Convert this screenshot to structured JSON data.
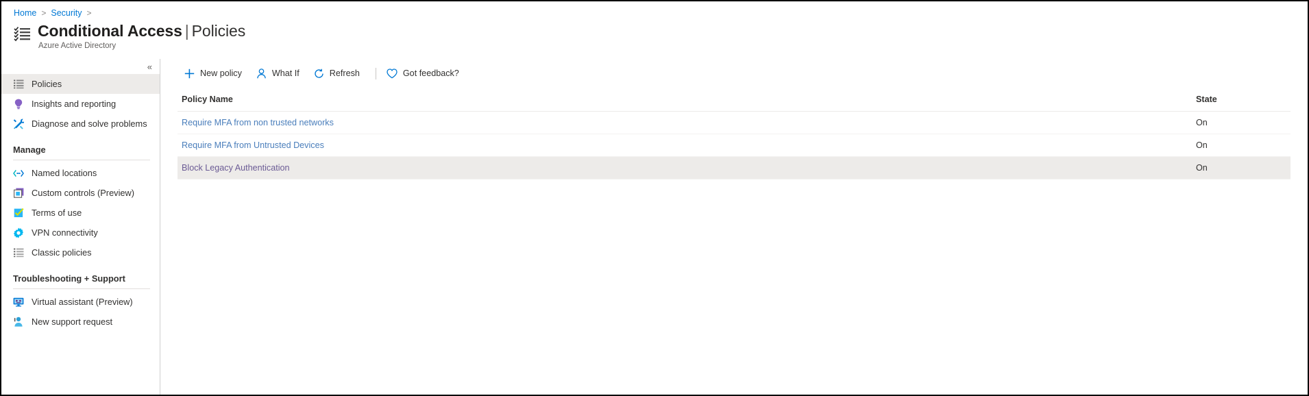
{
  "breadcrumb": {
    "items": [
      "Home",
      "Security"
    ],
    "separator": ">"
  },
  "header": {
    "title": "Conditional Access",
    "separator": "|",
    "subtitle_inline": "Policies",
    "subtitle": "Azure Active Directory",
    "icon": "checklist-icon"
  },
  "sidebar": {
    "collapse_label": "«",
    "top_items": [
      {
        "label": "Policies",
        "icon": "list-icon",
        "selected": true
      },
      {
        "label": "Insights and reporting",
        "icon": "lightbulb-icon",
        "selected": false
      },
      {
        "label": "Diagnose and solve problems",
        "icon": "wrench-icon",
        "selected": false
      }
    ],
    "groups": [
      {
        "header": "Manage",
        "items": [
          {
            "label": "Named locations",
            "icon": "code-brackets-icon"
          },
          {
            "label": "Custom controls (Preview)",
            "icon": "custom-control-icon"
          },
          {
            "label": "Terms of use",
            "icon": "checkbox-checked-icon"
          },
          {
            "label": "VPN connectivity",
            "icon": "gear-icon"
          },
          {
            "label": "Classic policies",
            "icon": "list-icon"
          }
        ]
      },
      {
        "header": "Troubleshooting + Support",
        "items": [
          {
            "label": "Virtual assistant (Preview)",
            "icon": "monitor-assistant-icon"
          },
          {
            "label": "New support request",
            "icon": "person-support-icon"
          }
        ]
      }
    ]
  },
  "toolbar": {
    "buttons": [
      {
        "label": "New policy",
        "icon": "plus-icon"
      },
      {
        "label": "What If",
        "icon": "person-icon"
      },
      {
        "label": "Refresh",
        "icon": "refresh-icon"
      }
    ],
    "feedback": {
      "label": "Got feedback?",
      "icon": "heart-icon"
    }
  },
  "table": {
    "columns": [
      "Policy Name",
      "State"
    ],
    "rows": [
      {
        "name": "Require MFA from non trusted networks",
        "state": "On",
        "highlighted": false
      },
      {
        "name": "Require MFA from Untrusted Devices",
        "state": "On",
        "highlighted": false
      },
      {
        "name": "Block Legacy Authentication",
        "state": "On",
        "highlighted": true
      }
    ]
  },
  "colors": {
    "link": "#0078d4",
    "policy_link": "#4a7ebb",
    "selected_bg": "#edebe9",
    "accent_purple": "#8661c5",
    "accent_cyan": "#00b7c3"
  }
}
